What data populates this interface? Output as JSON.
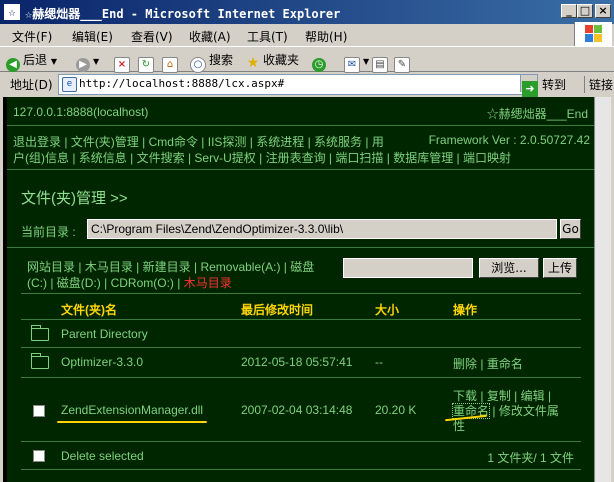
{
  "window": {
    "title": "☆赫缌炪器___End - Microsoft Internet Explorer",
    "controls": [
      "_",
      "□",
      "×"
    ]
  },
  "menu": {
    "items": [
      "文件(F)",
      "编辑(E)",
      "查看(V)",
      "收藏(A)",
      "工具(T)",
      "帮助(H)"
    ]
  },
  "toolbar": {
    "back_label": "后退",
    "search_label": "搜索",
    "favorites_label": "收藏夹"
  },
  "address": {
    "label": "地址(D)",
    "url": "http://localhost:8888/lcx.aspx#",
    "go_label": "转到",
    "links_label": "链接"
  },
  "site": {
    "host": "127.0.0.1:8888(localhost)",
    "brand": "☆赫缌炪器___End",
    "framework": "Framework Ver : 2.0.50727.42"
  },
  "nav": {
    "row1": [
      "退出登录",
      "文件(夹)管理",
      "Cmd命令",
      "IIS探测",
      "系统进程",
      "系统服务",
      "用"
    ],
    "row2": [
      "户(组)信息",
      "系统信息",
      "文件搜索",
      "Serv-U提权",
      "注册表查询",
      "端口扫描",
      "数据库管理",
      "端口映射"
    ]
  },
  "filemgr": {
    "title": "文件(夹)管理 >>",
    "current_dir_label": "当前目录 :",
    "current_dir_value": "C:\\Program Files\\Zend\\ZendOptimizer-3.3.0\\lib\\",
    "go_button": "Go",
    "drive_links_row1": [
      "网站目录",
      "木马目录",
      "新建目录",
      "Removable(A:)",
      "磁盘"
    ],
    "drive_links_row2_a": "(C:)",
    "drive_links_row2_b": "磁盘(D:)",
    "drive_links_row2_c": "CDRom(O:)",
    "trojan_dir": "木马目录",
    "browse_button": "浏览...",
    "upload_button": "上传",
    "columns": {
      "name": "文件(夹)名",
      "modified": "最后修改时间",
      "size": "大小",
      "action": "操作"
    },
    "rows": [
      {
        "name": "Parent Directory"
      },
      {
        "name": "Optimizer-3.3.0",
        "modified": "2012-05-18 05:57:41",
        "size": "--",
        "actions": [
          "删除",
          "重命名"
        ]
      },
      {
        "name": "ZendExtensionManager.dll",
        "modified": "2007-02-04 03:14:48",
        "size": "20.20 K",
        "actions": [
          "下载",
          "复制",
          "编辑",
          "重命名",
          "修改文件属",
          "性"
        ]
      }
    ],
    "footer_delete": "Delete selected",
    "footer_summary": "1 文件夹/ 1 文件"
  },
  "colors": {
    "page_bg": "#002600",
    "text": "#7fd17f",
    "heading": "#ffd500",
    "highlight": "#ff3030"
  }
}
